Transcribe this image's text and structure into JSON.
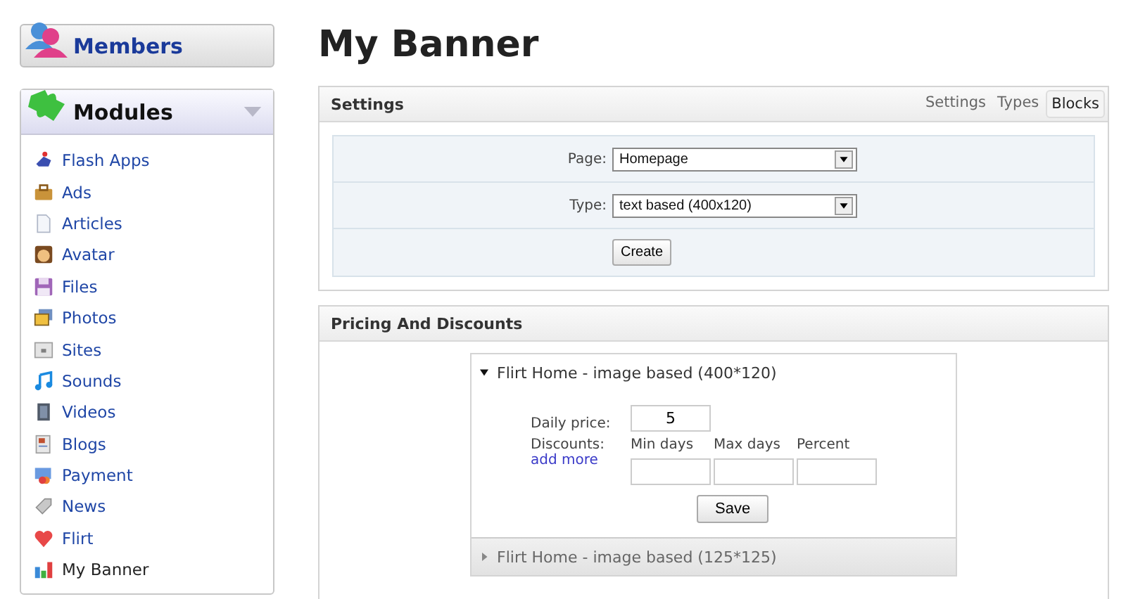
{
  "sidebar": {
    "members": {
      "label": "Members"
    },
    "modules": {
      "label": "Modules",
      "expanded": true,
      "items": [
        {
          "label": "Flash Apps",
          "selected": false
        },
        {
          "label": "Ads",
          "selected": false
        },
        {
          "label": "Articles",
          "selected": false
        },
        {
          "label": "Avatar",
          "selected": false
        },
        {
          "label": "Files",
          "selected": false
        },
        {
          "label": "Photos",
          "selected": false
        },
        {
          "label": "Sites",
          "selected": false
        },
        {
          "label": "Sounds",
          "selected": false
        },
        {
          "label": "Videos",
          "selected": false
        },
        {
          "label": "Blogs",
          "selected": false
        },
        {
          "label": "Payment",
          "selected": false
        },
        {
          "label": "News",
          "selected": false
        },
        {
          "label": "Flirt",
          "selected": false
        },
        {
          "label": "My Banner",
          "selected": true
        }
      ]
    }
  },
  "page_title": "My Banner",
  "settings": {
    "title": "Settings",
    "tabs": [
      {
        "label": "Settings",
        "selected": false
      },
      {
        "label": "Types",
        "selected": false
      },
      {
        "label": "Blocks",
        "selected": true
      }
    ],
    "fields": [
      {
        "label": "Page:",
        "value": "Homepage"
      },
      {
        "label": "Type:",
        "value": "text based (400x120)"
      }
    ],
    "button": "Create"
  },
  "pricing": {
    "title": "Pricing And Discounts",
    "blocks": [
      {
        "title": "Flirt Home - image based (400*120)",
        "expanded": true,
        "daily_price_label": "Daily price:",
        "daily_price": "5",
        "discounts_label": "Discounts:",
        "add_more": "add more",
        "columns": [
          "Min days",
          "Max days",
          "Percent"
        ],
        "button": "Save"
      },
      {
        "title": "Flirt Home - image based (125*125)",
        "expanded": false
      }
    ]
  }
}
